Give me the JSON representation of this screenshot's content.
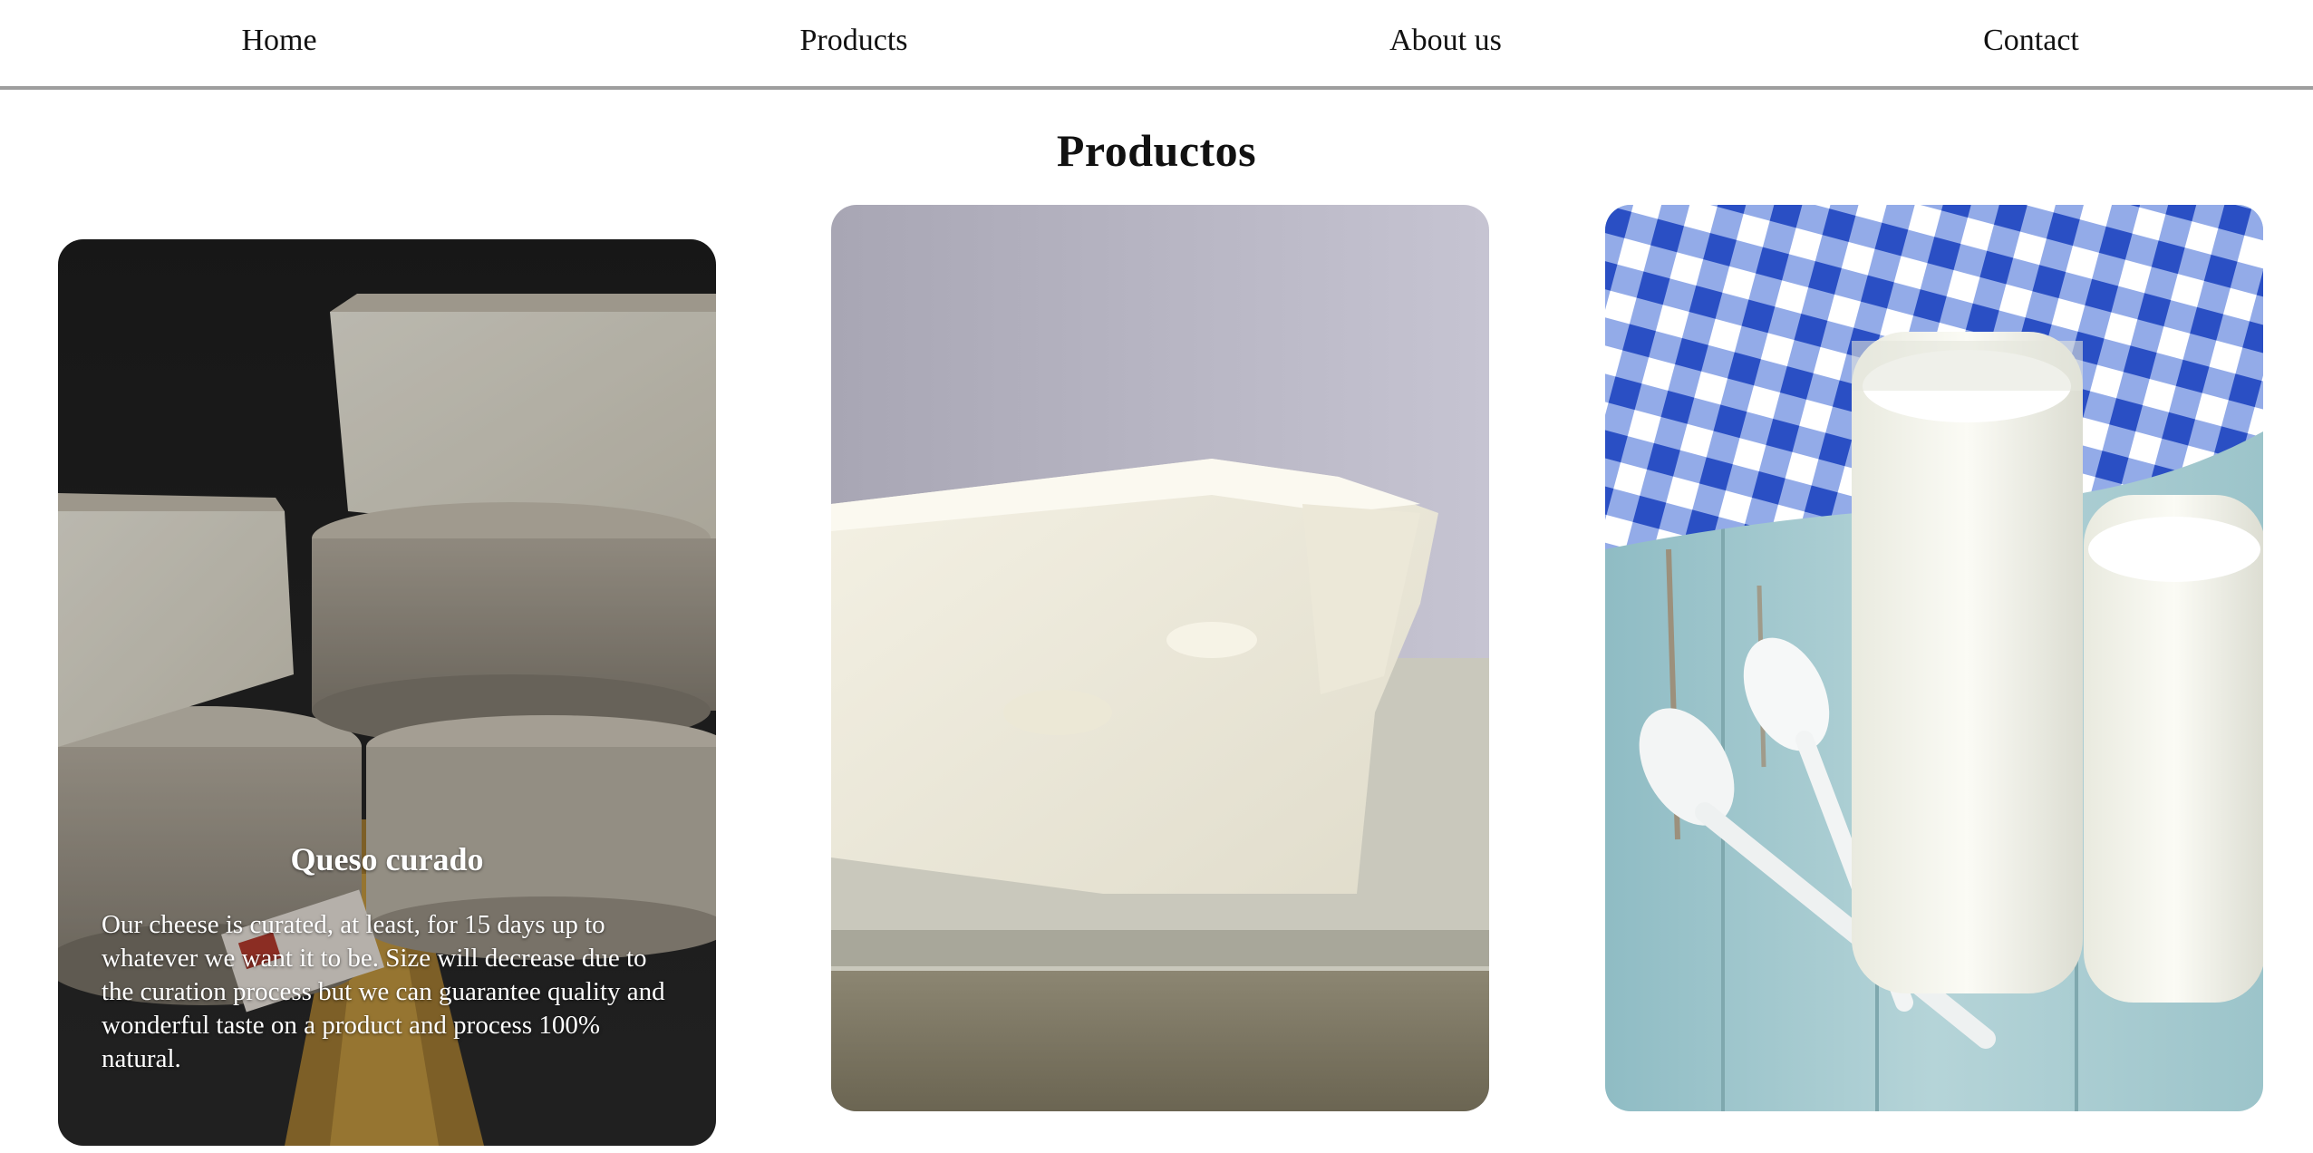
{
  "nav": {
    "items": [
      {
        "label": "Home"
      },
      {
        "label": "Products"
      },
      {
        "label": "About us"
      },
      {
        "label": "Contact"
      }
    ]
  },
  "main": {
    "title": "Productos"
  },
  "cards": [
    {
      "title": "Queso curado",
      "description": "Our cheese is curated, at least, for 15 days up to whatever we want it to be. Size will decrease due to the curation process but we can guarantee quality and wonderful taste on a product and process 100% natural.",
      "image": "aged-cheese-wheels-photo"
    },
    {
      "title": "",
      "description": "",
      "image": "fresh-white-cheese-photo"
    },
    {
      "title": "",
      "description": "",
      "image": "yogurt-jars-photo"
    }
  ],
  "colors": {
    "nav_border": "#9e9e9e",
    "text": "#111111",
    "card_text": "#ffffff"
  }
}
